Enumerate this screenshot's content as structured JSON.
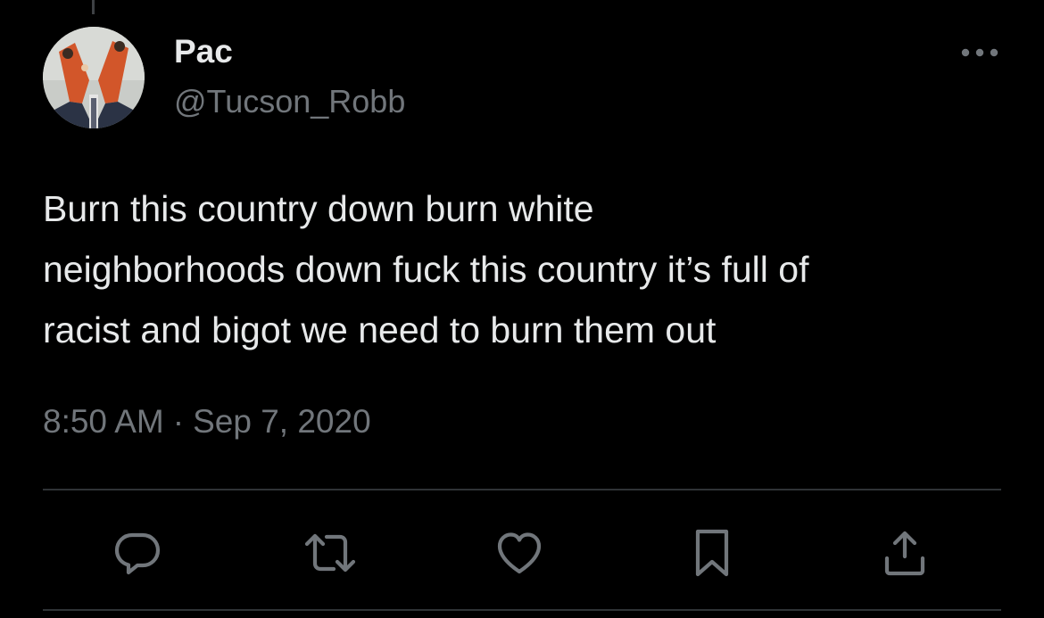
{
  "tweet": {
    "author_name": "Pac",
    "author_handle": "@Tucson_Robb",
    "text": "Burn this country down burn white\nneighborhoods down fuck this country it’s full of\nracist and bigot we need to burn them out",
    "time": "8:50 AM",
    "separator": "·",
    "date": "Sep 7, 2020"
  },
  "actions": [
    {
      "icon": "reply-icon"
    },
    {
      "icon": "retweet-icon"
    },
    {
      "icon": "like-icon"
    },
    {
      "icon": "bookmark-icon"
    },
    {
      "icon": "share-icon"
    }
  ],
  "colors": {
    "background": "#000000",
    "primary_text": "#e7e9ea",
    "secondary_text": "#71767b",
    "divider": "#2f3336"
  }
}
